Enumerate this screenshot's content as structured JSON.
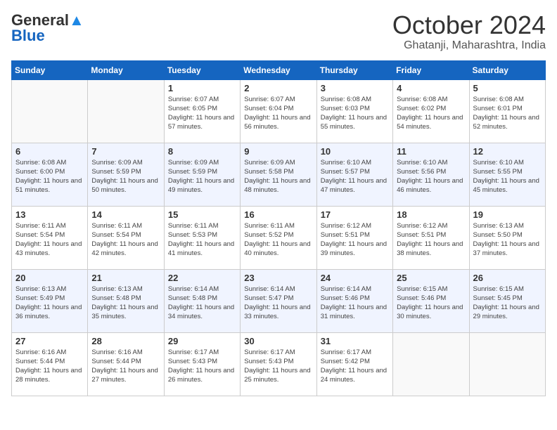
{
  "header": {
    "logo_general": "General",
    "logo_blue": "Blue",
    "title": "October 2024",
    "location": "Ghatanji, Maharashtra, India"
  },
  "weekdays": [
    "Sunday",
    "Monday",
    "Tuesday",
    "Wednesday",
    "Thursday",
    "Friday",
    "Saturday"
  ],
  "weeks": [
    [
      {
        "day": "",
        "empty": true
      },
      {
        "day": "",
        "empty": true
      },
      {
        "day": "1",
        "sunrise": "6:07 AM",
        "sunset": "6:05 PM",
        "daylight": "11 hours and 57 minutes."
      },
      {
        "day": "2",
        "sunrise": "6:07 AM",
        "sunset": "6:04 PM",
        "daylight": "11 hours and 56 minutes."
      },
      {
        "day": "3",
        "sunrise": "6:08 AM",
        "sunset": "6:03 PM",
        "daylight": "11 hours and 55 minutes."
      },
      {
        "day": "4",
        "sunrise": "6:08 AM",
        "sunset": "6:02 PM",
        "daylight": "11 hours and 54 minutes."
      },
      {
        "day": "5",
        "sunrise": "6:08 AM",
        "sunset": "6:01 PM",
        "daylight": "11 hours and 52 minutes."
      }
    ],
    [
      {
        "day": "6",
        "sunrise": "6:08 AM",
        "sunset": "6:00 PM",
        "daylight": "11 hours and 51 minutes."
      },
      {
        "day": "7",
        "sunrise": "6:09 AM",
        "sunset": "5:59 PM",
        "daylight": "11 hours and 50 minutes."
      },
      {
        "day": "8",
        "sunrise": "6:09 AM",
        "sunset": "5:59 PM",
        "daylight": "11 hours and 49 minutes."
      },
      {
        "day": "9",
        "sunrise": "6:09 AM",
        "sunset": "5:58 PM",
        "daylight": "11 hours and 48 minutes."
      },
      {
        "day": "10",
        "sunrise": "6:10 AM",
        "sunset": "5:57 PM",
        "daylight": "11 hours and 47 minutes."
      },
      {
        "day": "11",
        "sunrise": "6:10 AM",
        "sunset": "5:56 PM",
        "daylight": "11 hours and 46 minutes."
      },
      {
        "day": "12",
        "sunrise": "6:10 AM",
        "sunset": "5:55 PM",
        "daylight": "11 hours and 45 minutes."
      }
    ],
    [
      {
        "day": "13",
        "sunrise": "6:11 AM",
        "sunset": "5:54 PM",
        "daylight": "11 hours and 43 minutes."
      },
      {
        "day": "14",
        "sunrise": "6:11 AM",
        "sunset": "5:54 PM",
        "daylight": "11 hours and 42 minutes."
      },
      {
        "day": "15",
        "sunrise": "6:11 AM",
        "sunset": "5:53 PM",
        "daylight": "11 hours and 41 minutes."
      },
      {
        "day": "16",
        "sunrise": "6:11 AM",
        "sunset": "5:52 PM",
        "daylight": "11 hours and 40 minutes."
      },
      {
        "day": "17",
        "sunrise": "6:12 AM",
        "sunset": "5:51 PM",
        "daylight": "11 hours and 39 minutes."
      },
      {
        "day": "18",
        "sunrise": "6:12 AM",
        "sunset": "5:51 PM",
        "daylight": "11 hours and 38 minutes."
      },
      {
        "day": "19",
        "sunrise": "6:13 AM",
        "sunset": "5:50 PM",
        "daylight": "11 hours and 37 minutes."
      }
    ],
    [
      {
        "day": "20",
        "sunrise": "6:13 AM",
        "sunset": "5:49 PM",
        "daylight": "11 hours and 36 minutes."
      },
      {
        "day": "21",
        "sunrise": "6:13 AM",
        "sunset": "5:48 PM",
        "daylight": "11 hours and 35 minutes."
      },
      {
        "day": "22",
        "sunrise": "6:14 AM",
        "sunset": "5:48 PM",
        "daylight": "11 hours and 34 minutes."
      },
      {
        "day": "23",
        "sunrise": "6:14 AM",
        "sunset": "5:47 PM",
        "daylight": "11 hours and 33 minutes."
      },
      {
        "day": "24",
        "sunrise": "6:14 AM",
        "sunset": "5:46 PM",
        "daylight": "11 hours and 31 minutes."
      },
      {
        "day": "25",
        "sunrise": "6:15 AM",
        "sunset": "5:46 PM",
        "daylight": "11 hours and 30 minutes."
      },
      {
        "day": "26",
        "sunrise": "6:15 AM",
        "sunset": "5:45 PM",
        "daylight": "11 hours and 29 minutes."
      }
    ],
    [
      {
        "day": "27",
        "sunrise": "6:16 AM",
        "sunset": "5:44 PM",
        "daylight": "11 hours and 28 minutes."
      },
      {
        "day": "28",
        "sunrise": "6:16 AM",
        "sunset": "5:44 PM",
        "daylight": "11 hours and 27 minutes."
      },
      {
        "day": "29",
        "sunrise": "6:17 AM",
        "sunset": "5:43 PM",
        "daylight": "11 hours and 26 minutes."
      },
      {
        "day": "30",
        "sunrise": "6:17 AM",
        "sunset": "5:43 PM",
        "daylight": "11 hours and 25 minutes."
      },
      {
        "day": "31",
        "sunrise": "6:17 AM",
        "sunset": "5:42 PM",
        "daylight": "11 hours and 24 minutes."
      },
      {
        "day": "",
        "empty": true
      },
      {
        "day": "",
        "empty": true
      }
    ]
  ],
  "labels": {
    "sunrise": "Sunrise:",
    "sunset": "Sunset:",
    "daylight": "Daylight:"
  }
}
